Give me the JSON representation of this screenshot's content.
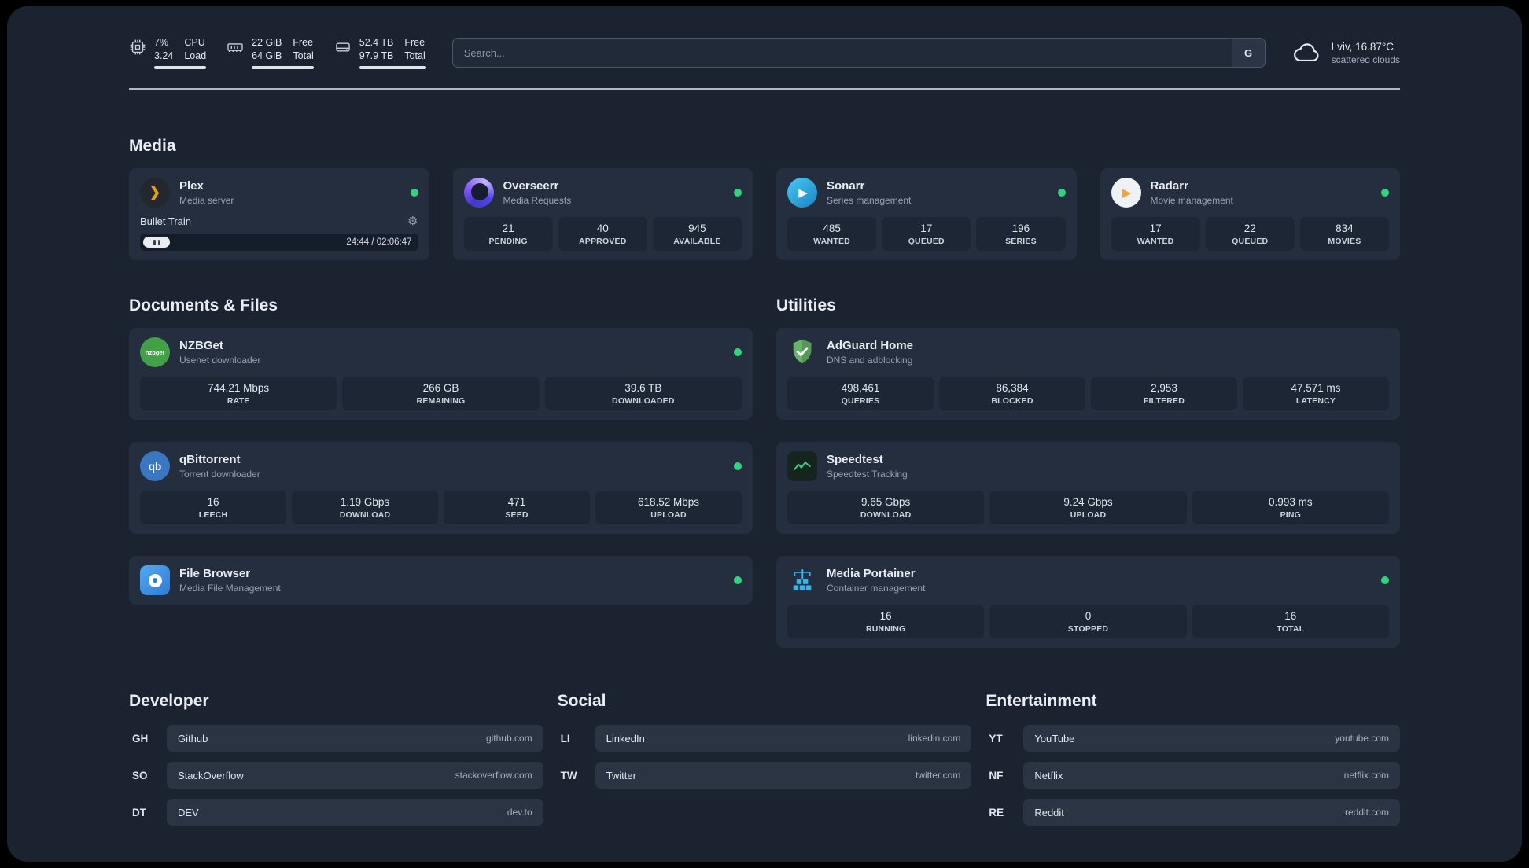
{
  "colors": {
    "background": "#1b2330",
    "card": "#242e3e",
    "stat_box": "#1d2634",
    "status_online": "#2ed47e",
    "plex_gold": "#e5a00d",
    "overseerr_purple": "#8b5cf6",
    "sonarr_blue": "#35c5f4",
    "radarr_orange": "#f2a33c",
    "nzbget_green": "#43a047",
    "qbittorrent_blue": "#3a77c2",
    "filebrowser_blue": "#2e7cd6",
    "adguard_green": "#67b368",
    "speedtest_green": "#35d08c",
    "portainer_blue": "#3ab3e8"
  },
  "icons": {
    "plex": "❯",
    "sonarr": "▶",
    "radarr": "▶",
    "qbittorrent": "qb",
    "nzbget": "nzbget",
    "gear": "⚙"
  },
  "topbar": {
    "cpu": {
      "value_top": "7%",
      "value_bottom": "3.24",
      "label_top": "CPU",
      "label_bottom": "Load"
    },
    "memory": {
      "value_top": "22 GiB",
      "value_bottom": "64 GiB",
      "label_top": "Free",
      "label_bottom": "Total"
    },
    "disk": {
      "value_top": "52.4 TB",
      "value_bottom": "97.9 TB",
      "label_top": "Free",
      "label_bottom": "Total"
    },
    "search": {
      "placeholder": "Search...",
      "provider": "G"
    },
    "weather": {
      "location": "Lviv, 16.87°C",
      "condition": "scattered clouds"
    }
  },
  "sections": {
    "media": "Media",
    "documents": "Documents & Files",
    "utilities": "Utilities"
  },
  "apps": {
    "plex": {
      "name": "Plex",
      "subtitle": "Media server",
      "player_title": "Bullet Train",
      "player_time": "24:44 / 02:06:47"
    },
    "overseerr": {
      "name": "Overseerr",
      "subtitle": "Media Requests",
      "stats": [
        {
          "value": "21",
          "label": "PENDING"
        },
        {
          "value": "40",
          "label": "APPROVED"
        },
        {
          "value": "945",
          "label": "AVAILABLE"
        }
      ]
    },
    "sonarr": {
      "name": "Sonarr",
      "subtitle": "Series management",
      "stats": [
        {
          "value": "485",
          "label": "WANTED"
        },
        {
          "value": "17",
          "label": "QUEUED"
        },
        {
          "value": "196",
          "label": "SERIES"
        }
      ]
    },
    "radarr": {
      "name": "Radarr",
      "subtitle": "Movie management",
      "stats": [
        {
          "value": "17",
          "label": "WANTED"
        },
        {
          "value": "22",
          "label": "QUEUED"
        },
        {
          "value": "834",
          "label": "MOVIES"
        }
      ]
    },
    "nzbget": {
      "name": "NZBGet",
      "subtitle": "Usenet downloader",
      "stats": [
        {
          "value": "744.21 Mbps",
          "label": "RATE"
        },
        {
          "value": "266 GB",
          "label": "REMAINING"
        },
        {
          "value": "39.6 TB",
          "label": "DOWNLOADED"
        }
      ]
    },
    "qbittorrent": {
      "name": "qBittorrent",
      "subtitle": "Torrent downloader",
      "stats": [
        {
          "value": "16",
          "label": "LEECH"
        },
        {
          "value": "1.19 Gbps",
          "label": "DOWNLOAD"
        },
        {
          "value": "471",
          "label": "SEED"
        },
        {
          "value": "618.52 Mbps",
          "label": "UPLOAD"
        }
      ]
    },
    "filebrowser": {
      "name": "File Browser",
      "subtitle": "Media File Management"
    },
    "adguard": {
      "name": "AdGuard Home",
      "subtitle": "DNS and adblocking",
      "stats": [
        {
          "value": "498,461",
          "label": "QUERIES"
        },
        {
          "value": "86,384",
          "label": "BLOCKED"
        },
        {
          "value": "2,953",
          "label": "FILTERED"
        },
        {
          "value": "47.571 ms",
          "label": "LATENCY"
        }
      ]
    },
    "speedtest": {
      "name": "Speedtest",
      "subtitle": "Speedtest Tracking",
      "stats": [
        {
          "value": "9.65 Gbps",
          "label": "DOWNLOAD"
        },
        {
          "value": "9.24 Gbps",
          "label": "UPLOAD"
        },
        {
          "value": "0.993 ms",
          "label": "PING"
        }
      ]
    },
    "portainer": {
      "name": "Media Portainer",
      "subtitle": "Container management",
      "stats": [
        {
          "value": "16",
          "label": "RUNNING"
        },
        {
          "value": "0",
          "label": "STOPPED"
        },
        {
          "value": "16",
          "label": "TOTAL"
        }
      ]
    }
  },
  "bookmarks": [
    {
      "title": "Developer",
      "items": [
        {
          "abbr": "GH",
          "name": "Github",
          "url": "github.com"
        },
        {
          "abbr": "SO",
          "name": "StackOverflow",
          "url": "stackoverflow.com"
        },
        {
          "abbr": "DT",
          "name": "DEV",
          "url": "dev.to"
        }
      ]
    },
    {
      "title": "Social",
      "items": [
        {
          "abbr": "LI",
          "name": "LinkedIn",
          "url": "linkedin.com"
        },
        {
          "abbr": "TW",
          "name": "Twitter",
          "url": "twitter.com"
        }
      ]
    },
    {
      "title": "Entertainment",
      "items": [
        {
          "abbr": "YT",
          "name": "YouTube",
          "url": "youtube.com"
        },
        {
          "abbr": "NF",
          "name": "Netflix",
          "url": "netflix.com"
        },
        {
          "abbr": "RE",
          "name": "Reddit",
          "url": "reddit.com"
        }
      ]
    }
  ]
}
